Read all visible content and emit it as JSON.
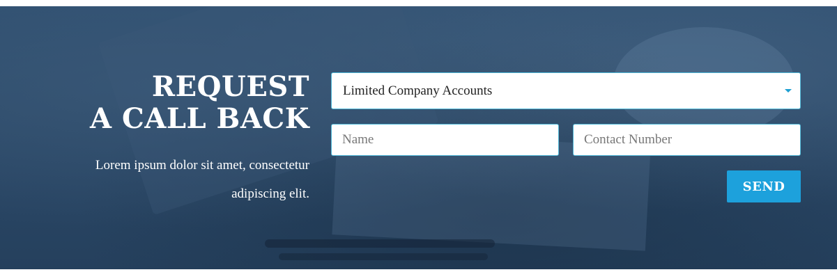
{
  "callback": {
    "heading_line1": "REQUEST",
    "heading_line2": "A CALL BACK",
    "description": "Lorem ipsum dolor sit amet, consectetur adipiscing elit."
  },
  "form": {
    "service_select": {
      "value": "Limited Company Accounts",
      "icon": "caret-down-icon"
    },
    "name_input": {
      "placeholder": "Name",
      "value": ""
    },
    "contact_input": {
      "placeholder": "Contact Number",
      "value": ""
    },
    "send_label": "SEND"
  },
  "colors": {
    "banner_overlay": "#2c4b6b",
    "accent": "#1da1dc",
    "field_border": "#4fb8d8",
    "text_light": "#ffffff"
  }
}
